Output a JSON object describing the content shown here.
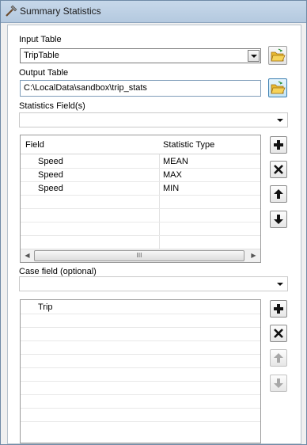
{
  "window": {
    "title": "Summary Statistics"
  },
  "input_table": {
    "label": "Input Table",
    "value": "TripTable"
  },
  "output_table": {
    "label": "Output Table",
    "value": "C:\\LocalData\\sandbox\\trip_stats"
  },
  "statistics_field": {
    "label": "Statistics Field(s)",
    "value": ""
  },
  "stats_grid": {
    "columns": [
      "Field",
      "Statistic Type"
    ],
    "rows": [
      {
        "field": "Speed",
        "stat": "MEAN"
      },
      {
        "field": "Speed",
        "stat": "MAX"
      },
      {
        "field": "Speed",
        "stat": "MIN"
      }
    ],
    "scroll_grip": "III"
  },
  "case_field": {
    "label": "Case field (optional)",
    "value": ""
  },
  "case_list": {
    "items": [
      "Trip"
    ]
  },
  "icons": {
    "title": "hammer-icon",
    "browse": "open-folder-icon",
    "add": "plus-icon",
    "remove": "x-icon",
    "up": "arrow-up-icon",
    "down": "arrow-down-icon"
  }
}
